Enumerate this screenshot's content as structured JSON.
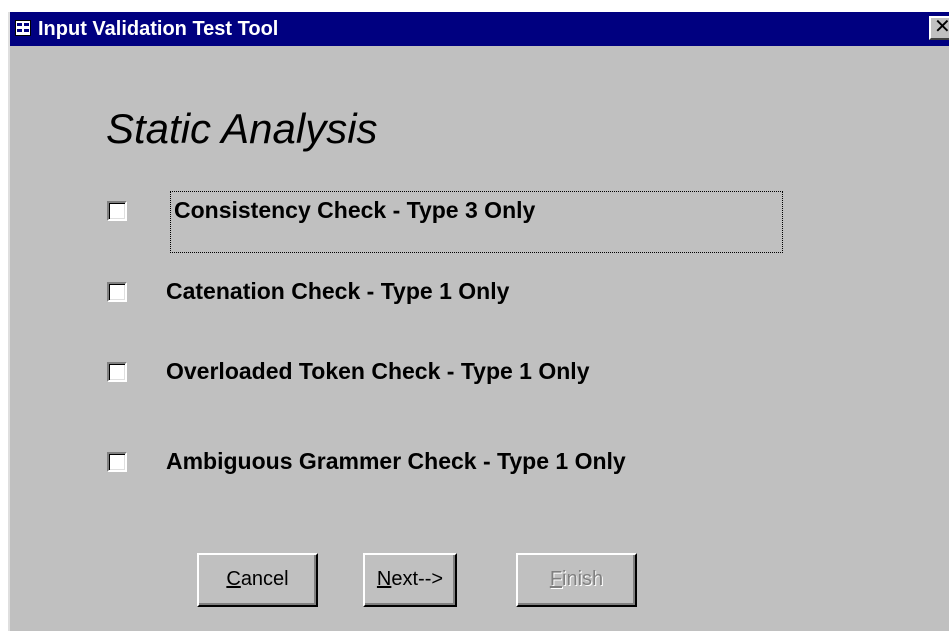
{
  "window": {
    "title": "Input Validation Test Tool",
    "close_symbol": "✕",
    "title_icon": "form-icon"
  },
  "main": {
    "heading": "Static Analysis",
    "options": [
      {
        "label": "Consistency Check - Type 3 Only",
        "checked": false,
        "focused": true
      },
      {
        "label": "Catenation Check - Type 1 Only",
        "checked": false
      },
      {
        "label": "Overloaded Token Check - Type 1 Only",
        "checked": false
      },
      {
        "label": "Ambiguous Grammer Check - Type 1 Only",
        "checked": false
      }
    ]
  },
  "buttons": {
    "cancel": {
      "accel": "C",
      "rest": "ancel"
    },
    "next": {
      "accel": "N",
      "rest": "ext-->"
    },
    "finish": {
      "accel": "F",
      "rest": "inish",
      "enabled": false
    }
  },
  "colors": {
    "titlebar": "#000080",
    "window_bg": "#c0c0c0",
    "disabled_text": "#808080"
  }
}
